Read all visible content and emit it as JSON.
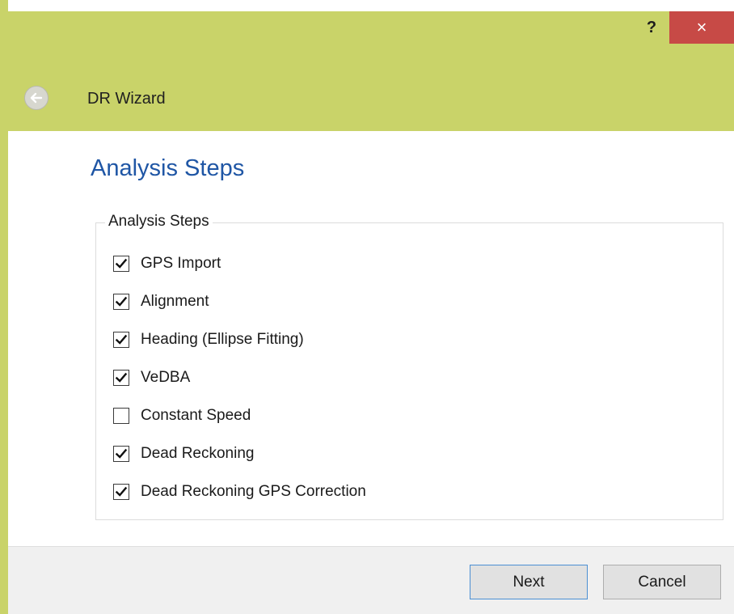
{
  "window": {
    "title": "DR Wizard",
    "help_label": "?",
    "close_label": "×",
    "accent_color": "#c9d369",
    "close_color": "#c74a46"
  },
  "page": {
    "title": "Analysis Steps"
  },
  "group": {
    "legend": "Analysis Steps",
    "steps": [
      {
        "label": "GPS Import",
        "checked": true
      },
      {
        "label": "Alignment",
        "checked": true
      },
      {
        "label": "Heading (Ellipse Fitting)",
        "checked": true
      },
      {
        "label": "VeDBA",
        "checked": true
      },
      {
        "label": "Constant Speed",
        "checked": false
      },
      {
        "label": "Dead Reckoning",
        "checked": true
      },
      {
        "label": "Dead Reckoning GPS Correction",
        "checked": true
      }
    ]
  },
  "footer": {
    "next_label": "Next",
    "cancel_label": "Cancel"
  }
}
